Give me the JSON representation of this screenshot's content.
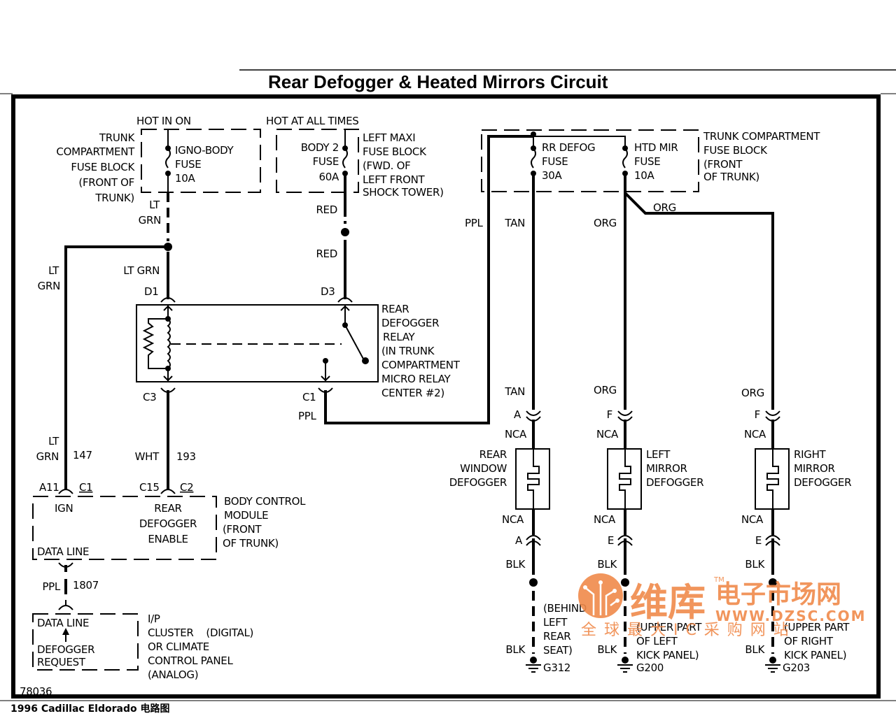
{
  "title": "Rear Defogger & Heated Mirrors Circuit",
  "footer": "1996   Cadillac   Eldorado   电路图",
  "diagram_id": "78036",
  "power": {
    "hot_in_on": "HOT IN ON",
    "hot_at_all_times": "HOT AT ALL TIMES"
  },
  "fuse_blocks": {
    "trunk_left": [
      "TRUNK",
      "COMPARTMENT",
      "FUSE BLOCK",
      "(FRONT OF",
      "TRUNK)"
    ],
    "left_maxi": [
      "LEFT MAXI",
      "FUSE BLOCK",
      "(FWD. OF",
      "LEFT FRONT",
      "SHOCK TOWER)"
    ],
    "trunk_right": [
      "TRUNK COMPARTMENT",
      "FUSE BLOCK",
      "(FRONT",
      "OF TRUNK)"
    ]
  },
  "fuses": [
    {
      "lines": [
        "IGNO-BODY",
        "FUSE",
        "10A"
      ]
    },
    {
      "lines": [
        "BODY 2",
        "FUSE",
        "60A"
      ]
    },
    {
      "lines": [
        "RR DEFOG",
        "FUSE",
        "30A"
      ]
    },
    {
      "lines": [
        "HTD MIR",
        "FUSE",
        "10A"
      ]
    }
  ],
  "wires": {
    "lt": "LT",
    "grn": "GRN",
    "lt_grn": "LT GRN",
    "red": "RED",
    "ppl": "PPL",
    "tan": "TAN",
    "org": "ORG",
    "wht": "WHT",
    "blk": "BLK",
    "nca": "NCA",
    "circuit_147": "147",
    "circuit_193": "193",
    "circuit_1807": "1807"
  },
  "connectors": {
    "d1": "D1",
    "d3": "D3",
    "c3": "C3",
    "c1": "C1",
    "a11": "A11",
    "c1_bcm": "C1",
    "c15": "C15",
    "c2": "C2",
    "a": "A",
    "f": "F",
    "e": "E"
  },
  "relay": [
    "REAR",
    "DEFOGGER",
    "RELAY",
    "(IN TRUNK",
    "COMPARTMENT",
    "MICRO RELAY",
    "CENTER #2)"
  ],
  "bcm": {
    "ign": "IGN",
    "enable": [
      "REAR",
      "DEFOGGER",
      "ENABLE"
    ],
    "data_line": "DATA LINE",
    "name": [
      "BODY CONTROL",
      "MODULE",
      "(FRONT",
      "OF TRUNK)"
    ]
  },
  "ip": {
    "data_line": "DATA LINE",
    "request": [
      "DEFOGGER",
      "REQUEST"
    ],
    "name": [
      "I/P",
      "CLUSTER    (DIGITAL)",
      "OR CLIMATE",
      "CONTROL PANEL",
      "(ANALOG)"
    ]
  },
  "loads": [
    {
      "name": [
        "REAR",
        "WINDOW",
        "DEFOGGER"
      ]
    },
    {
      "name": [
        "LEFT",
        "MIRROR",
        "DEFOGGER"
      ]
    },
    {
      "name": [
        "RIGHT",
        "MIRROR",
        "DEFOGGER"
      ]
    }
  ],
  "grounds": [
    {
      "id": "G312",
      "location": [
        "(BEHIND",
        "LEFT",
        "REAR",
        "SEAT)"
      ]
    },
    {
      "id": "G200",
      "location": [
        "(UPPER PART",
        "OF LEFT",
        "KICK PANEL)"
      ]
    },
    {
      "id": "G203",
      "location": [
        "(UPPER PART",
        "OF RIGHT",
        "KICK PANEL)"
      ]
    }
  ],
  "watermark": {
    "brand": "维库",
    "market": "电子市场网",
    "url": "WWW.DZSC.COM",
    "slogan": "全 球 最 大 I C 采 购 网 站",
    "tm": "TM",
    "color": "#f08a4b"
  }
}
